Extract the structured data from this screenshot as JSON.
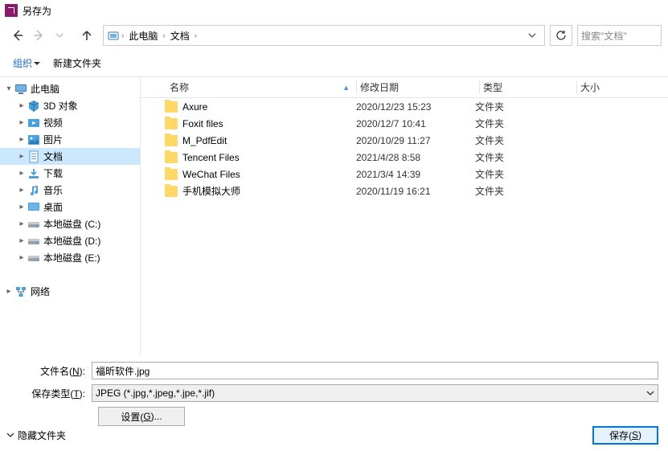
{
  "window": {
    "title": "另存为"
  },
  "nav": {
    "breadcrumb": [
      "此电脑",
      "文档"
    ],
    "search_placeholder": "搜索\"文档\""
  },
  "toolbar": {
    "organize": "组织",
    "new_folder": "新建文件夹"
  },
  "tree": {
    "items": [
      {
        "label": "此电脑",
        "indent": 0,
        "exp": "▾",
        "icon": "monitor",
        "sel": false
      },
      {
        "label": "3D 对象",
        "indent": 1,
        "exp": "▸",
        "icon": "cube",
        "sel": false
      },
      {
        "label": "视频",
        "indent": 1,
        "exp": "▸",
        "icon": "video",
        "sel": false
      },
      {
        "label": "图片",
        "indent": 1,
        "exp": "▸",
        "icon": "picture",
        "sel": false
      },
      {
        "label": "文档",
        "indent": 1,
        "exp": "▸",
        "icon": "doc",
        "sel": true
      },
      {
        "label": "下载",
        "indent": 1,
        "exp": "▸",
        "icon": "download",
        "sel": false
      },
      {
        "label": "音乐",
        "indent": 1,
        "exp": "▸",
        "icon": "music",
        "sel": false
      },
      {
        "label": "桌面",
        "indent": 1,
        "exp": "▸",
        "icon": "desktop",
        "sel": false
      },
      {
        "label": "本地磁盘 (C:)",
        "indent": 1,
        "exp": "▸",
        "icon": "drive",
        "sel": false
      },
      {
        "label": "本地磁盘 (D:)",
        "indent": 1,
        "exp": "▸",
        "icon": "drive",
        "sel": false
      },
      {
        "label": "本地磁盘 (E:)",
        "indent": 1,
        "exp": "▸",
        "icon": "drive",
        "sel": false
      },
      {
        "label": "",
        "indent": 0,
        "exp": "",
        "icon": "none",
        "sel": false
      },
      {
        "label": "网络",
        "indent": 0,
        "exp": "▸",
        "icon": "network",
        "sel": false
      }
    ]
  },
  "list": {
    "headers": {
      "name": "名称",
      "date": "修改日期",
      "type": "类型",
      "size": "大小"
    },
    "rows": [
      {
        "name": "Axure",
        "date": "2020/12/23 15:23",
        "type": "文件夹"
      },
      {
        "name": "Foxit files",
        "date": "2020/12/7 10:41",
        "type": "文件夹"
      },
      {
        "name": "M_PdfEdit",
        "date": "2020/10/29 11:27",
        "type": "文件夹"
      },
      {
        "name": "Tencent Files",
        "date": "2021/4/28 8:58",
        "type": "文件夹"
      },
      {
        "name": "WeChat Files",
        "date": "2021/3/4 14:39",
        "type": "文件夹"
      },
      {
        "name": "手机模拟大师",
        "date": "2020/11/19 16:21",
        "type": "文件夹"
      }
    ]
  },
  "form": {
    "filename_label_pre": "文件名(",
    "filename_label_u": "N",
    "filename_label_post": "):",
    "filename_value": "福昕软件.jpg",
    "type_label_pre": "保存类型(",
    "type_label_u": "T",
    "type_label_post": "):",
    "type_value": "JPEG (*.jpg,*.jpeg,*.jpe,*.jif)",
    "settings_pre": "设置(",
    "settings_u": "G",
    "settings_post": ")..."
  },
  "footer": {
    "hide_folders": "隐藏文件夹",
    "save_pre": "保存(",
    "save_u": "S",
    "save_post": ")"
  }
}
